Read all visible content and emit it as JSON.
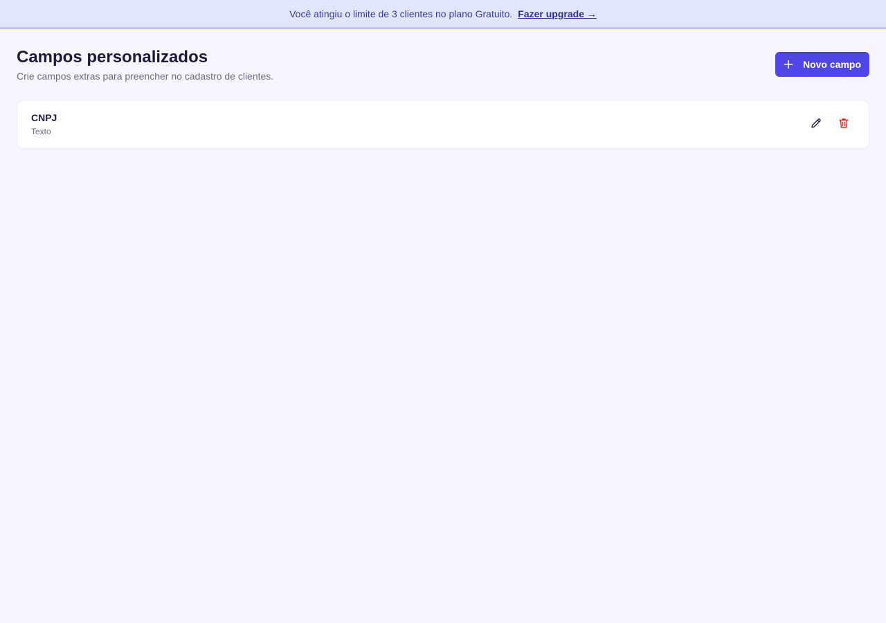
{
  "banner": {
    "message": "Você atingiu o limite de 3 clientes no plano Gratuito.",
    "link_label": "Fazer upgrade →"
  },
  "header": {
    "title": "Campos personalizados",
    "subtitle": "Crie campos extras para preencher no cadastro de clientes.",
    "new_button_label": "Novo campo"
  },
  "fields": [
    {
      "name": "CNPJ",
      "type": "Texto"
    }
  ],
  "icons": {
    "add": "plus-icon",
    "edit": "pencil-icon",
    "delete": "trash-icon"
  },
  "colors": {
    "accent": "#4f46e5",
    "danger": "#dc2626",
    "banner_bg": "#e1e6fd"
  }
}
